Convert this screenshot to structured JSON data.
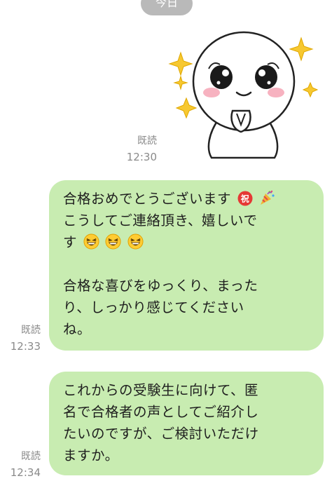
{
  "date_separator": "今日",
  "sticker_message": {
    "read_label": "既読",
    "time": "12:30"
  },
  "message_1": {
    "read_label": "既読",
    "time": "12:33",
    "line1": "合格おめでとうございます",
    "line2": "こうしてご連絡頂き、嬉しいで",
    "line3": "す",
    "line4": "合格な喜びをゆっくり、まった",
    "line5": "り、しっかり感じてくださいね",
    "line6": "ね。"
  },
  "message_2": {
    "read_label": "既読",
    "time": "12:34",
    "line1": "これからの受験生に向けて、匿",
    "line2": "名で合格者の声としてご紹介し",
    "line3": "たいのですが、ご検討いただけ",
    "line4": "ますか。"
  },
  "icons": [
    "celebration-kanji-icon",
    "party-popper-icon",
    "laughing-face-icon"
  ],
  "colors": {
    "bubble_green": "#c8ecb1",
    "meta_gray": "#8a8a8a",
    "date_pill": "#b9b9b9"
  }
}
